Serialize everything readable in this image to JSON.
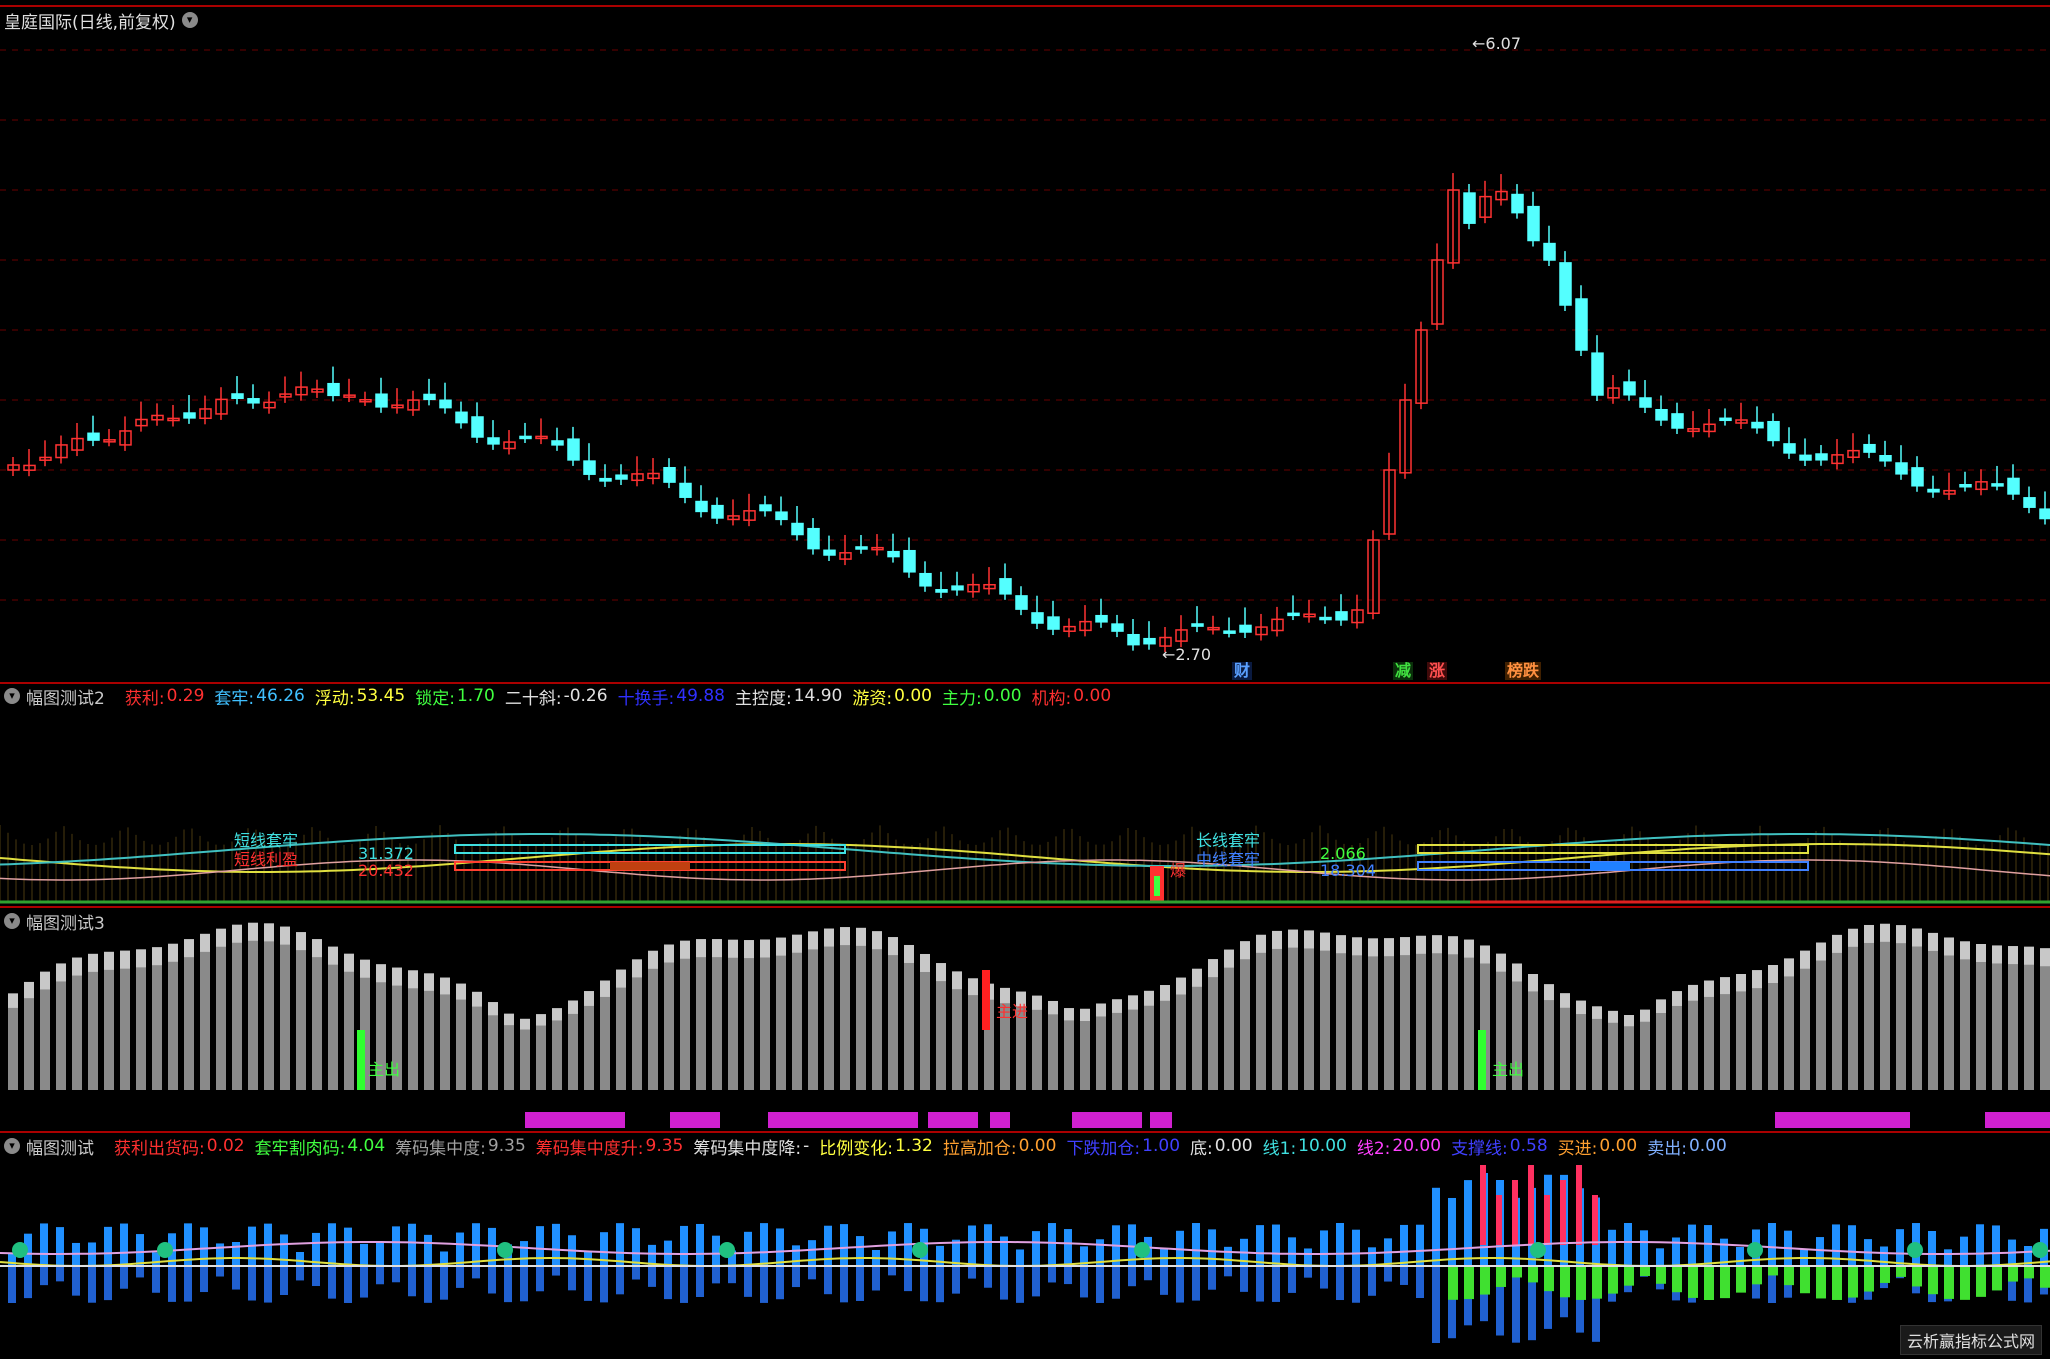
{
  "main": {
    "title": "皇庭国际(日线,前复权)",
    "high_label": "6.07",
    "low_label": "2.70",
    "markers": [
      {
        "text": "财",
        "color": "#5aa0ff"
      },
      {
        "text": "减",
        "color": "#40e040"
      },
      {
        "text": "涨",
        "color": "#ff5050"
      },
      {
        "text": "榜跌",
        "color": "#ff9040"
      }
    ]
  },
  "panel2": {
    "name": "幅图测试2",
    "fields": [
      {
        "label": "获利:",
        "value": "0.29",
        "color": "#ff3030"
      },
      {
        "label": "套牢:",
        "value": "46.26",
        "color": "#40c0ff"
      },
      {
        "label": "浮动:",
        "value": "53.45",
        "color": "#ffff40"
      },
      {
        "label": "锁定:",
        "value": "1.70",
        "color": "#40ff40"
      },
      {
        "label": "二十斜:",
        "value": "-0.26",
        "color": "#e0e0e0"
      },
      {
        "label": "十换手:",
        "value": "49.88",
        "color": "#3030ff"
      },
      {
        "label": "主控度:",
        "value": "14.90",
        "color": "#e0e0e0"
      },
      {
        "label": "游资:",
        "value": "0.00",
        "color": "#ffff40"
      },
      {
        "label": "主力:",
        "value": "0.00",
        "color": "#40ff40"
      },
      {
        "label": "机构:",
        "value": "0.00",
        "color": "#ff3030"
      }
    ],
    "labels": [
      {
        "text": "短线套牢",
        "color": "#40e0e0"
      },
      {
        "text": "短线利盈",
        "color": "#ff3030"
      },
      {
        "text": "31.372",
        "color": "#40e0e0"
      },
      {
        "text": "20.432",
        "color": "#ff3030"
      },
      {
        "text": "长线套牢",
        "color": "#40e0e0"
      },
      {
        "text": "中线套牢",
        "color": "#4080ff"
      },
      {
        "text": "2.066",
        "color": "#40ff40"
      },
      {
        "text": "18.304",
        "color": "#4080ff"
      },
      {
        "text": "爆",
        "color": "#ff3030"
      }
    ]
  },
  "panel3": {
    "name": "幅图测试3",
    "labels": [
      {
        "text": "主出",
        "color": "#40ff40"
      },
      {
        "text": "主进",
        "color": "#ff3030"
      },
      {
        "text": "主出",
        "color": "#40ff40"
      }
    ]
  },
  "panel4": {
    "name": "幅图测试",
    "fields": [
      {
        "label": "获利出货码:",
        "value": "0.02",
        "color": "#ff3030"
      },
      {
        "label": "套牢割肉码:",
        "value": "4.04",
        "color": "#40ff40"
      },
      {
        "label": "筹码集中度:",
        "value": "9.35",
        "color": "#a0a0a0"
      },
      {
        "label": "筹码集中度升:",
        "value": "9.35",
        "color": "#ff3030"
      },
      {
        "label": "筹码集中度降:",
        "value": "-",
        "color": "#e0e0e0"
      },
      {
        "label": "比例变化:",
        "value": "1.32",
        "color": "#ffff40"
      },
      {
        "label": "拉高加仓:",
        "value": "0.00",
        "color": "#ffa030"
      },
      {
        "label": "下跌加仓:",
        "value": "1.00",
        "color": "#4040ff"
      },
      {
        "label": "底:",
        "value": "0.00",
        "color": "#e0e0e0"
      },
      {
        "label": "线1:",
        "value": "10.00",
        "color": "#40e0e0"
      },
      {
        "label": "线2:",
        "value": "20.00",
        "color": "#ff40ff"
      },
      {
        "label": "支撑线:",
        "value": "0.58",
        "color": "#4040ff"
      },
      {
        "label": "买进:",
        "value": "0.00",
        "color": "#ffa030"
      },
      {
        "label": "卖出:",
        "value": "0.00",
        "color": "#80b0ff"
      }
    ]
  },
  "watermark": "云析赢指标公式网",
  "colors": {
    "up": "#ff3232",
    "down": "#54ffff",
    "bg": "#000000",
    "grid": "#6a0000",
    "separator": "#aa0000"
  }
}
